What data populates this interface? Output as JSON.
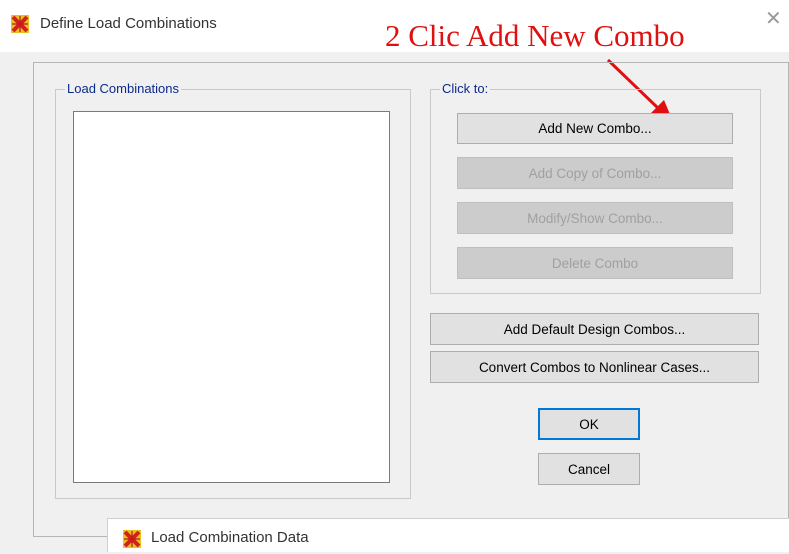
{
  "window": {
    "title": "Define Load Combinations",
    "icon": "sap2000-app-icon",
    "close_glyph": "✕"
  },
  "annotation": {
    "text": "2 Clic Add New Combo",
    "color": "#e01010"
  },
  "load_combinations": {
    "legend": "Load Combinations",
    "items": []
  },
  "click_to": {
    "legend": "Click to:",
    "add_new": "Add New Combo...",
    "add_copy": "Add Copy of Combo...",
    "modify_show": "Modify/Show Combo...",
    "delete": "Delete Combo"
  },
  "actions": {
    "add_default": "Add Default Design Combos...",
    "convert": "Convert Combos to Nonlinear Cases...",
    "ok": "OK",
    "cancel": "Cancel"
  },
  "sub_window": {
    "title": "Load Combination Data",
    "icon": "sap2000-app-icon"
  },
  "colors": {
    "accent": "#0078d7",
    "legend_text": "#0b2a8c",
    "icon_bg": "#e8c020",
    "icon_x": "#d42020"
  }
}
